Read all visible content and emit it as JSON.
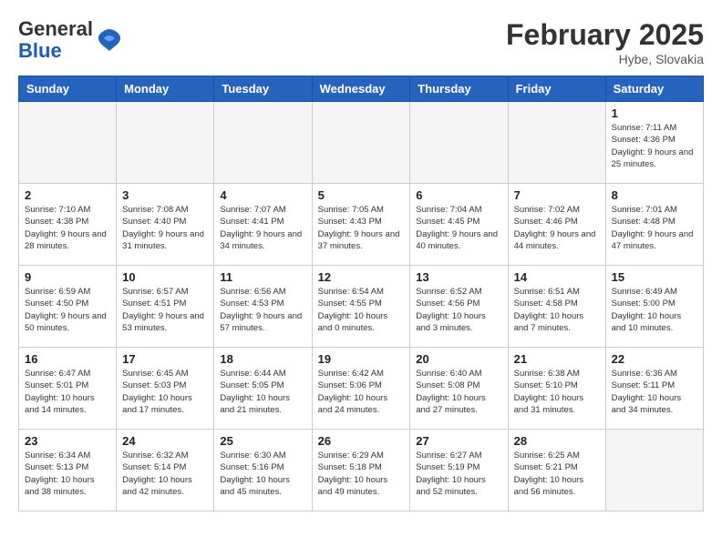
{
  "header": {
    "logo_general": "General",
    "logo_blue": "Blue",
    "month_title": "February 2025",
    "location": "Hybe, Slovakia"
  },
  "weekdays": [
    "Sunday",
    "Monday",
    "Tuesday",
    "Wednesday",
    "Thursday",
    "Friday",
    "Saturday"
  ],
  "weeks": [
    [
      {
        "day": "",
        "detail": ""
      },
      {
        "day": "",
        "detail": ""
      },
      {
        "day": "",
        "detail": ""
      },
      {
        "day": "",
        "detail": ""
      },
      {
        "day": "",
        "detail": ""
      },
      {
        "day": "",
        "detail": ""
      },
      {
        "day": "1",
        "detail": "Sunrise: 7:11 AM\nSunset: 4:36 PM\nDaylight: 9 hours\nand 25 minutes."
      }
    ],
    [
      {
        "day": "2",
        "detail": "Sunrise: 7:10 AM\nSunset: 4:38 PM\nDaylight: 9 hours\nand 28 minutes."
      },
      {
        "day": "3",
        "detail": "Sunrise: 7:08 AM\nSunset: 4:40 PM\nDaylight: 9 hours\nand 31 minutes."
      },
      {
        "day": "4",
        "detail": "Sunrise: 7:07 AM\nSunset: 4:41 PM\nDaylight: 9 hours\nand 34 minutes."
      },
      {
        "day": "5",
        "detail": "Sunrise: 7:05 AM\nSunset: 4:43 PM\nDaylight: 9 hours\nand 37 minutes."
      },
      {
        "day": "6",
        "detail": "Sunrise: 7:04 AM\nSunset: 4:45 PM\nDaylight: 9 hours\nand 40 minutes."
      },
      {
        "day": "7",
        "detail": "Sunrise: 7:02 AM\nSunset: 4:46 PM\nDaylight: 9 hours\nand 44 minutes."
      },
      {
        "day": "8",
        "detail": "Sunrise: 7:01 AM\nSunset: 4:48 PM\nDaylight: 9 hours\nand 47 minutes."
      }
    ],
    [
      {
        "day": "9",
        "detail": "Sunrise: 6:59 AM\nSunset: 4:50 PM\nDaylight: 9 hours\nand 50 minutes."
      },
      {
        "day": "10",
        "detail": "Sunrise: 6:57 AM\nSunset: 4:51 PM\nDaylight: 9 hours\nand 53 minutes."
      },
      {
        "day": "11",
        "detail": "Sunrise: 6:56 AM\nSunset: 4:53 PM\nDaylight: 9 hours\nand 57 minutes."
      },
      {
        "day": "12",
        "detail": "Sunrise: 6:54 AM\nSunset: 4:55 PM\nDaylight: 10 hours\nand 0 minutes."
      },
      {
        "day": "13",
        "detail": "Sunrise: 6:52 AM\nSunset: 4:56 PM\nDaylight: 10 hours\nand 3 minutes."
      },
      {
        "day": "14",
        "detail": "Sunrise: 6:51 AM\nSunset: 4:58 PM\nDaylight: 10 hours\nand 7 minutes."
      },
      {
        "day": "15",
        "detail": "Sunrise: 6:49 AM\nSunset: 5:00 PM\nDaylight: 10 hours\nand 10 minutes."
      }
    ],
    [
      {
        "day": "16",
        "detail": "Sunrise: 6:47 AM\nSunset: 5:01 PM\nDaylight: 10 hours\nand 14 minutes."
      },
      {
        "day": "17",
        "detail": "Sunrise: 6:45 AM\nSunset: 5:03 PM\nDaylight: 10 hours\nand 17 minutes."
      },
      {
        "day": "18",
        "detail": "Sunrise: 6:44 AM\nSunset: 5:05 PM\nDaylight: 10 hours\nand 21 minutes."
      },
      {
        "day": "19",
        "detail": "Sunrise: 6:42 AM\nSunset: 5:06 PM\nDaylight: 10 hours\nand 24 minutes."
      },
      {
        "day": "20",
        "detail": "Sunrise: 6:40 AM\nSunset: 5:08 PM\nDaylight: 10 hours\nand 27 minutes."
      },
      {
        "day": "21",
        "detail": "Sunrise: 6:38 AM\nSunset: 5:10 PM\nDaylight: 10 hours\nand 31 minutes."
      },
      {
        "day": "22",
        "detail": "Sunrise: 6:36 AM\nSunset: 5:11 PM\nDaylight: 10 hours\nand 34 minutes."
      }
    ],
    [
      {
        "day": "23",
        "detail": "Sunrise: 6:34 AM\nSunset: 5:13 PM\nDaylight: 10 hours\nand 38 minutes."
      },
      {
        "day": "24",
        "detail": "Sunrise: 6:32 AM\nSunset: 5:14 PM\nDaylight: 10 hours\nand 42 minutes."
      },
      {
        "day": "25",
        "detail": "Sunrise: 6:30 AM\nSunset: 5:16 PM\nDaylight: 10 hours\nand 45 minutes."
      },
      {
        "day": "26",
        "detail": "Sunrise: 6:29 AM\nSunset: 5:18 PM\nDaylight: 10 hours\nand 49 minutes."
      },
      {
        "day": "27",
        "detail": "Sunrise: 6:27 AM\nSunset: 5:19 PM\nDaylight: 10 hours\nand 52 minutes."
      },
      {
        "day": "28",
        "detail": "Sunrise: 6:25 AM\nSunset: 5:21 PM\nDaylight: 10 hours\nand 56 minutes."
      },
      {
        "day": "",
        "detail": ""
      }
    ]
  ]
}
